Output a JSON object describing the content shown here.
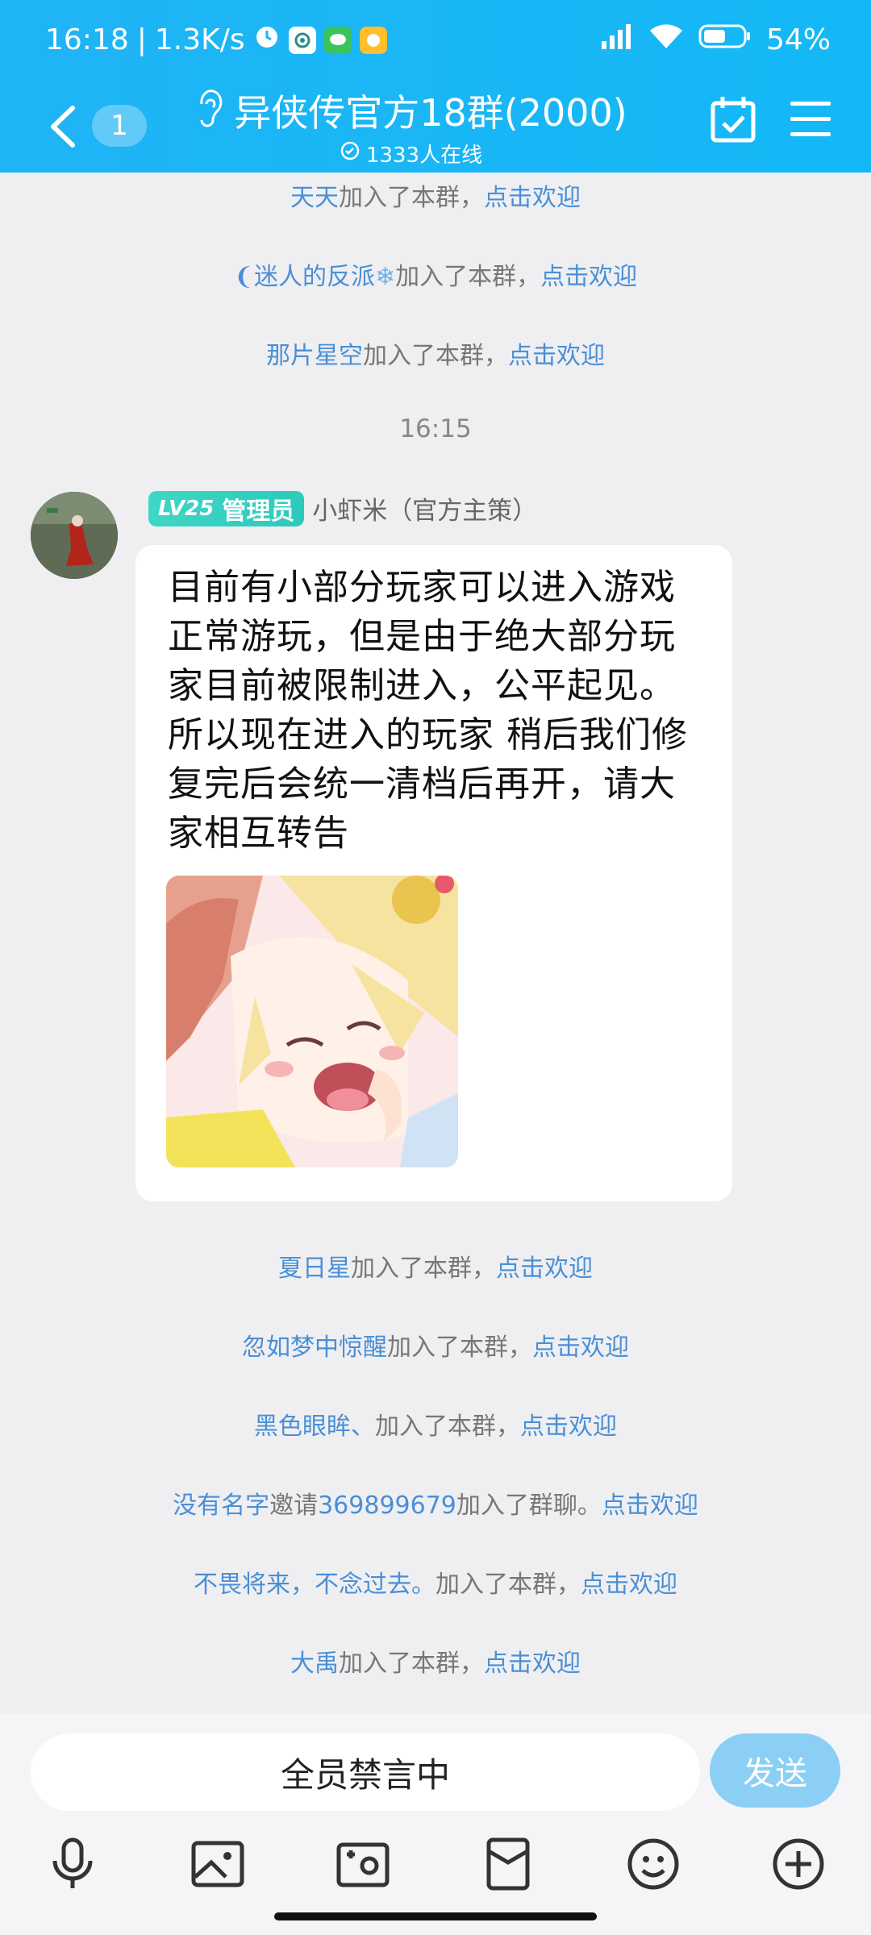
{
  "status_bar": {
    "time": "16:18",
    "speed": "1.3K/s",
    "battery": "54%"
  },
  "header": {
    "unread_count": "1",
    "title": "异侠传官方18群(2000)",
    "online": "1333人在线"
  },
  "system_messages_top": [
    {
      "user": "天天",
      "action": "加入了本群，",
      "welcome": "点击欢迎"
    },
    {
      "user": "迷人的反派",
      "action": "加入了本群，",
      "welcome": "点击欢迎"
    },
    {
      "user": "那片星空",
      "action": "加入了本群，",
      "welcome": "点击欢迎"
    }
  ],
  "timestamp": "16:15",
  "message": {
    "level": "LV25",
    "role": "管理员",
    "sender": "小虾米（官方主策）",
    "text": "目前有小部分玩家可以进入游戏正常游玩，但是由于绝大部分玩家目前被限制进入，公平起见。所以现在进入的玩家 稍后我们修复完后会统一清档后再开，请大家相互转告"
  },
  "system_messages_bottom": [
    {
      "user": "夏日星",
      "action": "加入了本群，",
      "welcome": "点击欢迎"
    },
    {
      "user": "忽如梦中惊醒",
      "action": "加入了本群，",
      "welcome": "点击欢迎"
    },
    {
      "user": "黑色眼眸、",
      "action": "加入了本群，",
      "welcome": "点击欢迎"
    },
    {
      "user": "没有名字",
      "mid": "邀请",
      "user2": "369899679",
      "action": "加入了群聊。",
      "welcome": "点击欢迎"
    },
    {
      "user": "不畏将来，不念过去。",
      "action": "加入了本群，",
      "welcome": "点击欢迎"
    },
    {
      "user": "大禹",
      "action": "加入了本群，",
      "welcome": "点击欢迎"
    }
  ],
  "input": {
    "placeholder": "全员禁言中",
    "send_label": "发送"
  }
}
